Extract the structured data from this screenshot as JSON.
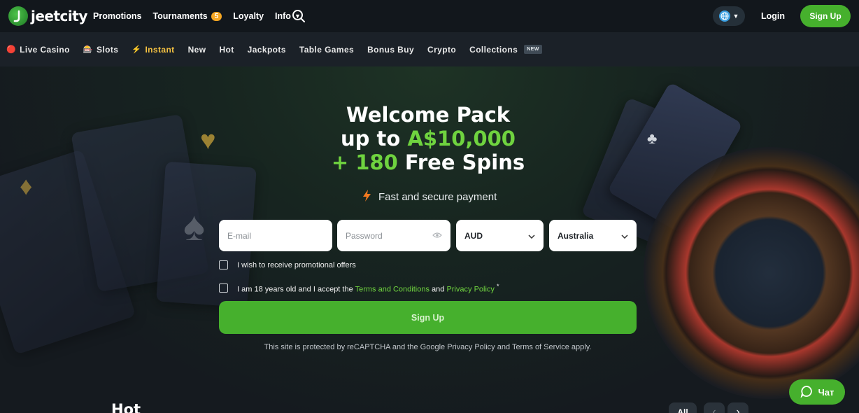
{
  "brand": {
    "name": "jeetcity",
    "accent": "#46b02d"
  },
  "topnav": {
    "promotions": "Promotions",
    "tournaments": "Tournaments",
    "tournaments_count": "5",
    "loyalty": "Loyalty",
    "info": "Info"
  },
  "header": {
    "login": "Login",
    "signup": "Sign Up"
  },
  "categories": {
    "live_casino": "Live Casino",
    "slots": "Slots",
    "instant": "Instant",
    "new": "New",
    "hot": "Hot",
    "jackpots": "Jackpots",
    "table_games": "Table Games",
    "bonus_buy": "Bonus Buy",
    "crypto": "Crypto",
    "collections": "Collections",
    "new_tag": "NEW"
  },
  "hero": {
    "line1": "Welcome Pack",
    "line2_prefix": "up to",
    "line2_amount": "A$10,000",
    "line3_prefix": "+ 180",
    "line3_suffix": "Free Spins",
    "payment_text": "Fast and secure payment"
  },
  "form": {
    "email_placeholder": "E-mail",
    "password_placeholder": "Password",
    "currency": "AUD",
    "country": "Australia",
    "promo_offers": "I wish to receive promotional offers",
    "age_text_prefix": "I am 18 years old and I accept the",
    "terms_link": "Terms and Conditions",
    "and_text": "and",
    "privacy_link": "Privacy Policy",
    "required_mark": "*",
    "signup_button": "Sign Up",
    "recaptcha_text": "This site is protected by reCAPTCHA and the Google Privacy Policy and Terms of Service apply."
  },
  "section": {
    "hot_heading": "Hot",
    "all_button": "All"
  },
  "chat": {
    "label": "Чат"
  }
}
